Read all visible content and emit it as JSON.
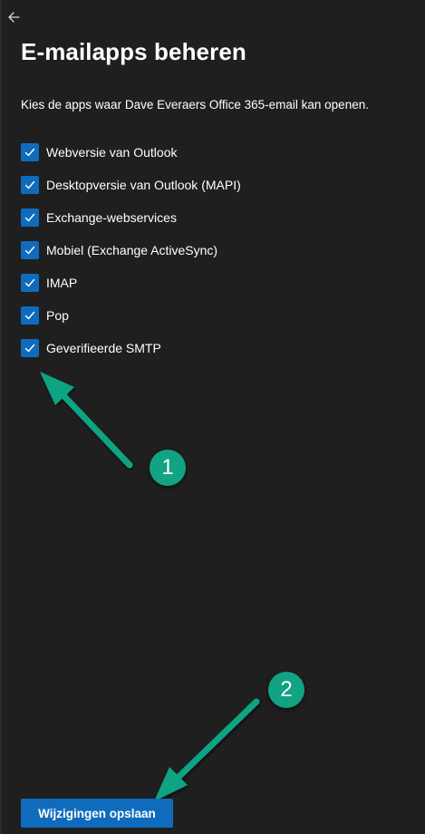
{
  "header": {
    "back_icon": "arrow-left-icon",
    "title": "E-mailapps beheren"
  },
  "description": "Kies de apps waar Dave Everaers Office 365-email kan openen.",
  "apps": [
    {
      "label": "Webversie van Outlook",
      "checked": true
    },
    {
      "label": "Desktopversie van Outlook (MAPI)",
      "checked": true
    },
    {
      "label": "Exchange-webservices",
      "checked": true
    },
    {
      "label": "Mobiel (Exchange ActiveSync)",
      "checked": true
    },
    {
      "label": "IMAP",
      "checked": true
    },
    {
      "label": "Pop",
      "checked": true
    },
    {
      "label": "Geverifieerde SMTP",
      "checked": true
    }
  ],
  "annotations": [
    {
      "number": "1"
    },
    {
      "number": "2"
    }
  ],
  "footer": {
    "save_label": "Wijzigingen opslaan"
  },
  "colors": {
    "background": "#1f1f1f",
    "accent": "#0f6cbd",
    "annotation": "#11a383",
    "text": "#ffffff"
  }
}
